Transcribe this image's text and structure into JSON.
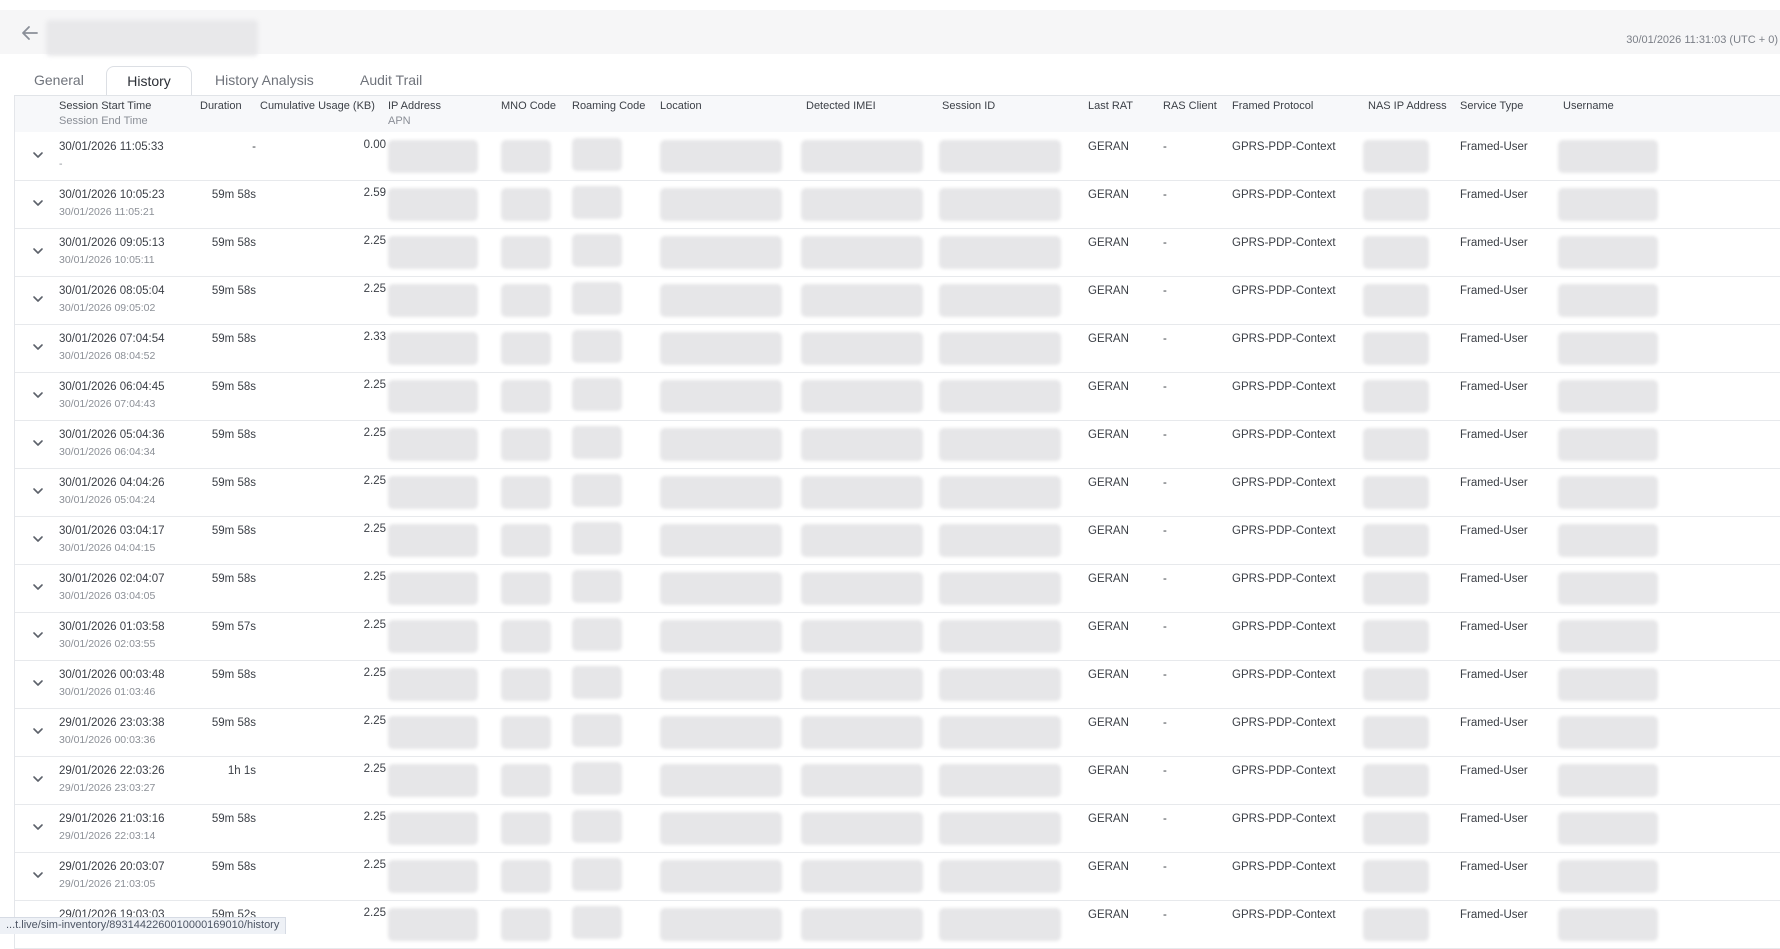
{
  "header": {
    "timestamp": "30/01/2026 11:31:03 (UTC + 0)"
  },
  "tabs": [
    {
      "label": "General"
    },
    {
      "label": "History"
    },
    {
      "label": "History Analysis"
    },
    {
      "label": "Audit Trail"
    }
  ],
  "active_tab": "History",
  "columns": {
    "start": "Session Start Time",
    "end": "Session End Time",
    "duration": "Duration",
    "usage": "Cumulative Usage (KB)",
    "ip": "IP Address",
    "apn": "APN",
    "mno": "MNO Code",
    "roaming": "Roaming Code",
    "location": "Location",
    "imei": "Detected IMEI",
    "session": "Session ID",
    "rat": "Last RAT",
    "ras": "RAS Client",
    "protocol": "Framed Protocol",
    "nas": "NAS IP Address",
    "service": "Service Type",
    "username": "Username"
  },
  "rows": [
    {
      "start": "30/01/2026 11:05:33",
      "end": "-",
      "duration": "-",
      "usage": "0.00",
      "rat": "GERAN",
      "ras": "-",
      "protocol": "GPRS-PDP-Context",
      "service": "Framed-User"
    },
    {
      "start": "30/01/2026 10:05:23",
      "end": "30/01/2026 11:05:21",
      "duration": "59m 58s",
      "usage": "2.59",
      "rat": "GERAN",
      "ras": "-",
      "protocol": "GPRS-PDP-Context",
      "service": "Framed-User"
    },
    {
      "start": "30/01/2026 09:05:13",
      "end": "30/01/2026 10:05:11",
      "duration": "59m 58s",
      "usage": "2.25",
      "rat": "GERAN",
      "ras": "-",
      "protocol": "GPRS-PDP-Context",
      "service": "Framed-User"
    },
    {
      "start": "30/01/2026 08:05:04",
      "end": "30/01/2026 09:05:02",
      "duration": "59m 58s",
      "usage": "2.25",
      "rat": "GERAN",
      "ras": "-",
      "protocol": "GPRS-PDP-Context",
      "service": "Framed-User"
    },
    {
      "start": "30/01/2026 07:04:54",
      "end": "30/01/2026 08:04:52",
      "duration": "59m 58s",
      "usage": "2.33",
      "rat": "GERAN",
      "ras": "-",
      "protocol": "GPRS-PDP-Context",
      "service": "Framed-User"
    },
    {
      "start": "30/01/2026 06:04:45",
      "end": "30/01/2026 07:04:43",
      "duration": "59m 58s",
      "usage": "2.25",
      "rat": "GERAN",
      "ras": "-",
      "protocol": "GPRS-PDP-Context",
      "service": "Framed-User"
    },
    {
      "start": "30/01/2026 05:04:36",
      "end": "30/01/2026 06:04:34",
      "duration": "59m 58s",
      "usage": "2.25",
      "rat": "GERAN",
      "ras": "-",
      "protocol": "GPRS-PDP-Context",
      "service": "Framed-User"
    },
    {
      "start": "30/01/2026 04:04:26",
      "end": "30/01/2026 05:04:24",
      "duration": "59m 58s",
      "usage": "2.25",
      "rat": "GERAN",
      "ras": "-",
      "protocol": "GPRS-PDP-Context",
      "service": "Framed-User"
    },
    {
      "start": "30/01/2026 03:04:17",
      "end": "30/01/2026 04:04:15",
      "duration": "59m 58s",
      "usage": "2.25",
      "rat": "GERAN",
      "ras": "-",
      "protocol": "GPRS-PDP-Context",
      "service": "Framed-User"
    },
    {
      "start": "30/01/2026 02:04:07",
      "end": "30/01/2026 03:04:05",
      "duration": "59m 58s",
      "usage": "2.25",
      "rat": "GERAN",
      "ras": "-",
      "protocol": "GPRS-PDP-Context",
      "service": "Framed-User"
    },
    {
      "start": "30/01/2026 01:03:58",
      "end": "30/01/2026 02:03:55",
      "duration": "59m 57s",
      "usage": "2.25",
      "rat": "GERAN",
      "ras": "-",
      "protocol": "GPRS-PDP-Context",
      "service": "Framed-User"
    },
    {
      "start": "30/01/2026 00:03:48",
      "end": "30/01/2026 01:03:46",
      "duration": "59m 58s",
      "usage": "2.25",
      "rat": "GERAN",
      "ras": "-",
      "protocol": "GPRS-PDP-Context",
      "service": "Framed-User"
    },
    {
      "start": "29/01/2026 23:03:38",
      "end": "30/01/2026 00:03:36",
      "duration": "59m 58s",
      "usage": "2.25",
      "rat": "GERAN",
      "ras": "-",
      "protocol": "GPRS-PDP-Context",
      "service": "Framed-User"
    },
    {
      "start": "29/01/2026 22:03:26",
      "end": "29/01/2026 23:03:27",
      "duration": "1h 1s",
      "usage": "2.25",
      "rat": "GERAN",
      "ras": "-",
      "protocol": "GPRS-PDP-Context",
      "service": "Framed-User"
    },
    {
      "start": "29/01/2026 21:03:16",
      "end": "29/01/2026 22:03:14",
      "duration": "59m 58s",
      "usage": "2.25",
      "rat": "GERAN",
      "ras": "-",
      "protocol": "GPRS-PDP-Context",
      "service": "Framed-User"
    },
    {
      "start": "29/01/2026 20:03:07",
      "end": "29/01/2026 21:03:05",
      "duration": "59m 58s",
      "usage": "2.25",
      "rat": "GERAN",
      "ras": "-",
      "protocol": "GPRS-PDP-Context",
      "service": "Framed-User"
    },
    {
      "start": "29/01/2026 19:03:03",
      "end": "",
      "duration": "59m 52s",
      "usage": "2.25",
      "rat": "GERAN",
      "ras": "-",
      "protocol": "GPRS-PDP-Context",
      "service": "Framed-User"
    }
  ],
  "status_bar": {
    "url": "...t.live/sim-inventory/8931442260010000169010/history"
  }
}
